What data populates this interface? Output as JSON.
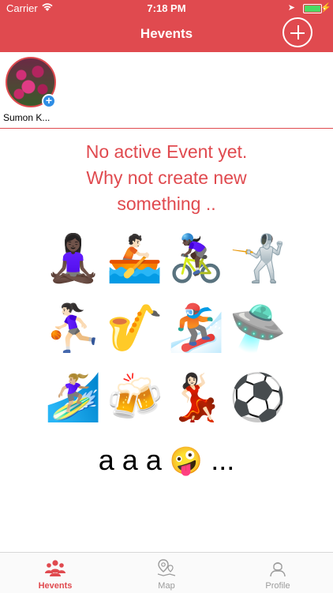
{
  "status_bar": {
    "carrier": "Carrier",
    "time": "7:18 PM"
  },
  "nav": {
    "title": "Hevents",
    "add_icon": "plus-circle-icon"
  },
  "friends": [
    {
      "name": "Sumon K...",
      "badge": "+"
    }
  ],
  "empty_state": {
    "line1": "No active Event yet.",
    "line2": "Why not create new",
    "line3": "something .."
  },
  "emojis": [
    "🧘🏿‍♀️",
    "🚣🏻",
    "🚴🏿‍♀️",
    "🤺",
    "⛹🏻‍♀️",
    "🎷",
    "🏂🏿",
    "🛸",
    "🏄🏼‍♀️",
    "🍻",
    "💃🏻",
    "⚽"
  ],
  "tagline": {
    "text_before": "a a a",
    "emoji": "🤪",
    "text_after": "..."
  },
  "tabs": [
    {
      "label": "Hevents",
      "icon": "people-group-icon",
      "active": true
    },
    {
      "label": "Map",
      "icon": "map-pin-icon",
      "active": false
    },
    {
      "label": "Profile",
      "icon": "profile-person-icon",
      "active": false
    }
  ],
  "colors": {
    "brand_red": "#e04a4f",
    "inactive_gray": "#9b9b9b",
    "badge_blue": "#2f8ee5",
    "battery_green": "#4cd964"
  }
}
